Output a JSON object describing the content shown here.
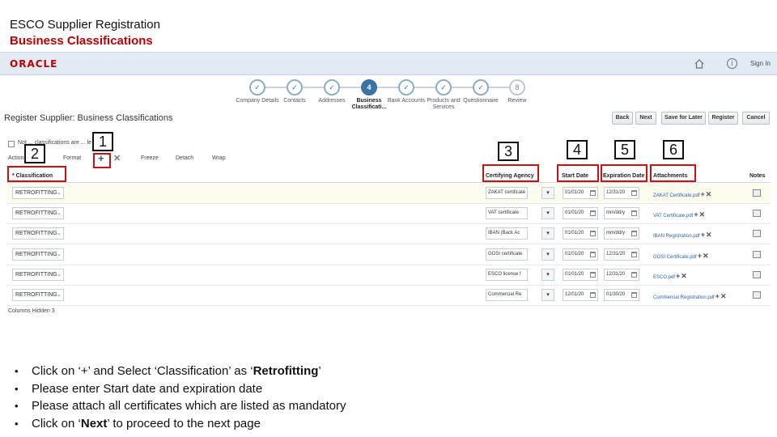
{
  "slide": {
    "title": "ESCO Supplier  Registration",
    "subtitle": "Business Classifications"
  },
  "topbar": {
    "logo": "ORACLE",
    "sign_in": "Sign In"
  },
  "train": [
    {
      "label": "Company Details",
      "state": "done",
      "glyph": "✓"
    },
    {
      "label": "Contacts",
      "state": "done",
      "glyph": "✓"
    },
    {
      "label": "Addresses",
      "state": "done",
      "glyph": "✓"
    },
    {
      "label": "Business Classificati...",
      "state": "current",
      "glyph": "4"
    },
    {
      "label": "Bank Accounts",
      "state": "done",
      "glyph": "✓"
    },
    {
      "label": "Products and Services",
      "state": "done",
      "glyph": "✓"
    },
    {
      "label": "Questionnaire",
      "state": "done",
      "glyph": "✓"
    },
    {
      "label": "Review",
      "state": "todo",
      "glyph": "8"
    }
  ],
  "page": {
    "title": "Register Supplier: Business Classifications"
  },
  "buttons": {
    "back": "Back",
    "next": "Next",
    "save_for_later": "Save for Later",
    "register": "Register",
    "cancel": "Cancel"
  },
  "toolbar": {
    "checkbox_label": "Not ... classifications are ... le",
    "actions": "Actions",
    "format": "Format",
    "freeze": "Freeze",
    "detach": "Detach",
    "wrap": "Wrap"
  },
  "table": {
    "headers": {
      "classification": "* Classification",
      "certifying_agency": "Certifying Agency",
      "start_date": "Start Date",
      "expiration_date": "Expiration Date",
      "attachments": "Attachments",
      "notes": "Notes"
    },
    "rows": [
      {
        "classification": "RETROFITTING",
        "agency": "ZAKAT certificate",
        "start": "01/01/20",
        "expiry": "12/31/20",
        "attachment": "ZAKAT Certificate.pdf"
      },
      {
        "classification": "RETROFITTING",
        "agency": "VAT certificate",
        "start": "01/01/20",
        "expiry": "mm/dd/y",
        "attachment": "VAT Certificate.pdf"
      },
      {
        "classification": "RETROFITTING",
        "agency": "IBAN (Back Ac",
        "start": "01/01/20",
        "expiry": "mm/dd/y",
        "attachment": "IBAN Registration.pdf"
      },
      {
        "classification": "RETROFITTING",
        "agency": "GOSI certificate",
        "start": "01/01/20",
        "expiry": "12/31/20",
        "attachment": "GOSI Certificate.pdf"
      },
      {
        "classification": "RETROFITTING",
        "agency": "ESCO license f",
        "start": "01/01/20",
        "expiry": "12/31/20",
        "attachment": "ESCO.pdf"
      },
      {
        "classification": "RETROFITTING",
        "agency": "Commercial Re",
        "start": "12/01/20",
        "expiry": "01/30/20",
        "attachment": "Commercial Registration.pdf"
      }
    ],
    "columns_hidden": "Columns Hidden  3"
  },
  "callouts": {
    "n1": "1",
    "n2": "2",
    "n3": "3",
    "n4": "4",
    "n5": "5",
    "n6": "6"
  },
  "instructions": {
    "b1": {
      "pre": "Click on ‘+’ and Select ‘Classification’ as ‘",
      "bold": "Retrofitting",
      "post": "’"
    },
    "b2": "Please enter Start date and expiration date",
    "b3": "Please attach all certificates which are listed as mandatory",
    "b4": {
      "pre": "Click on ‘",
      "bold": "Next",
      "post": "’ to proceed to the next page"
    }
  },
  "colors": {
    "accent_red": "#d01010",
    "oracle_red": "#c00000",
    "current_step": "#3b73a8",
    "link_blue": "#2a63a8"
  }
}
